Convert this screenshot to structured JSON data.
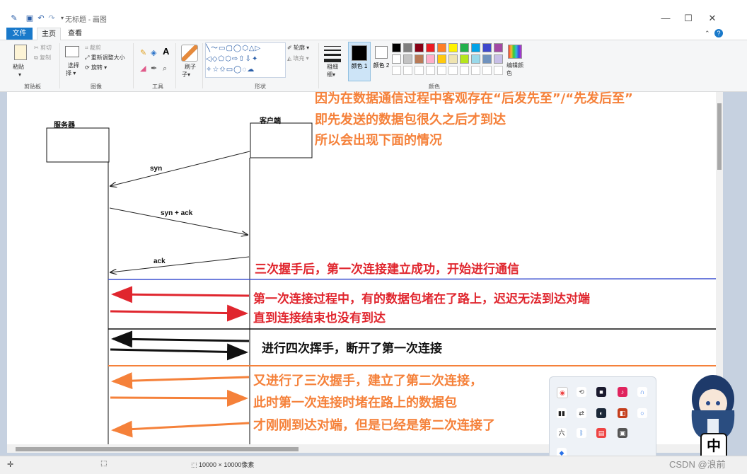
{
  "app": {
    "title": "无标题 - 画图"
  },
  "titlebar": {
    "minimize": "—",
    "maximize": "☐",
    "close": "✕"
  },
  "tabs": {
    "file": "文件",
    "home": "主页",
    "view": "查看"
  },
  "ribbon": {
    "clipboard": {
      "paste": "粘贴",
      "cut": "剪切",
      "copy": "复制",
      "label": "剪贴板"
    },
    "image": {
      "select": "选择",
      "crop": "裁剪",
      "resize": "重新调整大小",
      "rotate": "旋转",
      "label": "图像"
    },
    "tools": {
      "label": "工具"
    },
    "brushes": {
      "label": "刷子"
    },
    "shapes": {
      "outline": "轮廓",
      "fill": "填充",
      "label": "形状"
    },
    "size": {
      "label": "粗细"
    },
    "color1": {
      "label": "颜色 1"
    },
    "color2": {
      "label": "颜色 2"
    },
    "colors": {
      "label": "颜色",
      "edit": "编辑颜色",
      "palette_row1": [
        "#000000",
        "#7f7f7f",
        "#880015",
        "#ed1c24",
        "#ff7f27",
        "#fff200",
        "#22b14c",
        "#00a2e8",
        "#3f48cc",
        "#a349a4"
      ],
      "palette_row2": [
        "#ffffff",
        "#c3c3c3",
        "#b97a57",
        "#ffaec9",
        "#ffc90e",
        "#efe4b0",
        "#b5e61d",
        "#99d9ea",
        "#7092be",
        "#c8bfe7"
      ]
    }
  },
  "diagram": {
    "server_label": "服务器",
    "client_label": "客户端",
    "syn": "syn",
    "synack": "syn + ack",
    "ack": "ack"
  },
  "annotations": {
    "top_line1": "因为在数据通信过程中客观存在“后发先至”/“先发后至”",
    "top_line2": "即先发送的数据包很久之后才到达",
    "top_line3": "所以会出现下面的情况",
    "handshake_done": "三次握手后，第一次连接建立成功，开始进行通信",
    "stuck_line1": "第一次连接过程中，有的数据包堵在了路上，迟迟无法到达对端",
    "stuck_line2": "直到连接结束也没有到达",
    "four_wave": "进行四次挥手，断开了第一次连接",
    "second_line1": "又进行了三次握手，建立了第二次连接，",
    "second_line2": "此时第一次连接时堵在路上的数据包",
    "second_line3": "才刚刚到达对端，但是已经是第二次连接了"
  },
  "statusbar": {
    "canvas_size": "10000 × 10000像素"
  },
  "ime": "中",
  "watermark": "CSDN @浪前"
}
